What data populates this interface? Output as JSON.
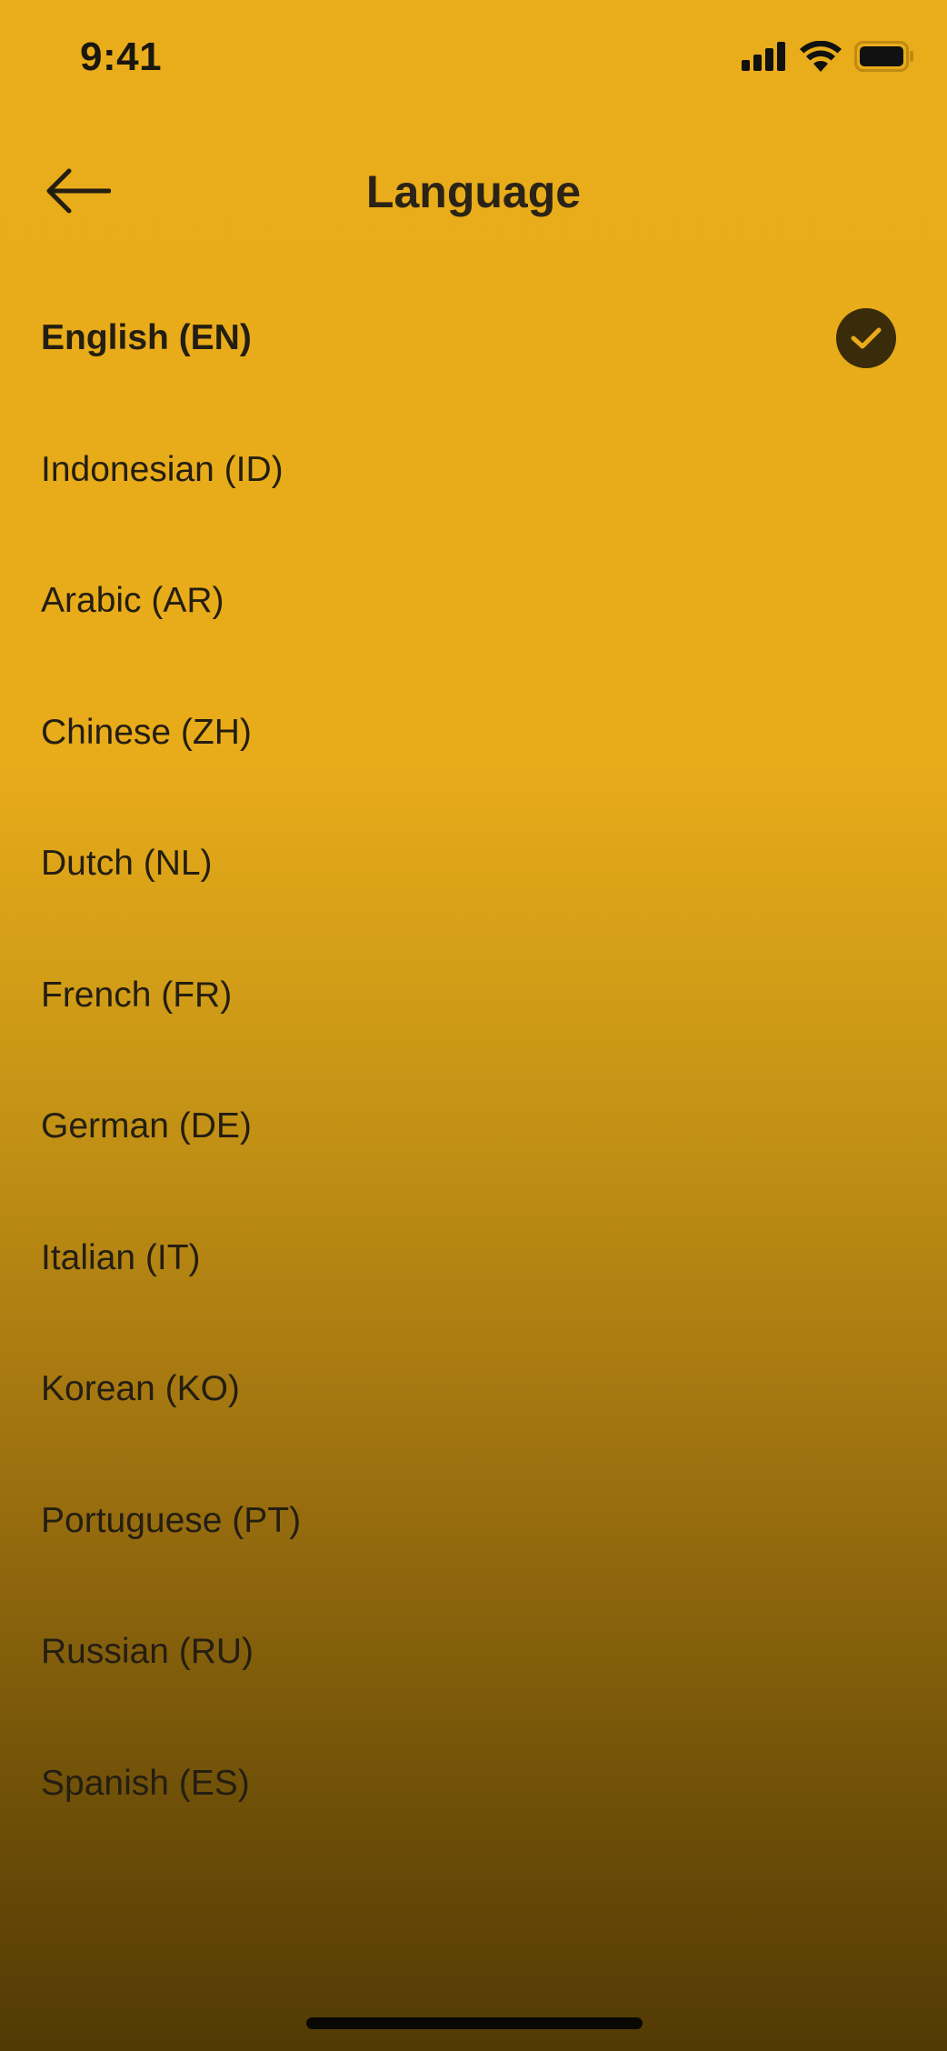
{
  "status_bar": {
    "time": "9:41",
    "signal_icon": "cellular-signal-icon",
    "wifi_icon": "wifi-icon",
    "battery_icon": "battery-icon"
  },
  "header": {
    "title": "Language",
    "back_icon": "arrow-left-icon"
  },
  "languages": [
    {
      "label": "English (EN)",
      "selected": true
    },
    {
      "label": "Indonesian (ID)",
      "selected": false
    },
    {
      "label": "Arabic (AR)",
      "selected": false
    },
    {
      "label": "Chinese (ZH)",
      "selected": false
    },
    {
      "label": "Dutch (NL)",
      "selected": false
    },
    {
      "label": "French (FR)",
      "selected": false
    },
    {
      "label": "German (DE)",
      "selected": false
    },
    {
      "label": "Italian (IT)",
      "selected": false
    },
    {
      "label": "Korean (KO)",
      "selected": false
    },
    {
      "label": "Portuguese (PT)",
      "selected": false
    },
    {
      "label": "Russian (RU)",
      "selected": false
    },
    {
      "label": "Spanish (ES)",
      "selected": false
    }
  ],
  "colors": {
    "background_top": "#e9ac1a",
    "background_bottom": "#523a05",
    "check_badge": "#3a2b0a",
    "check_mark": "#e9ac1a",
    "text": "#241e12"
  }
}
